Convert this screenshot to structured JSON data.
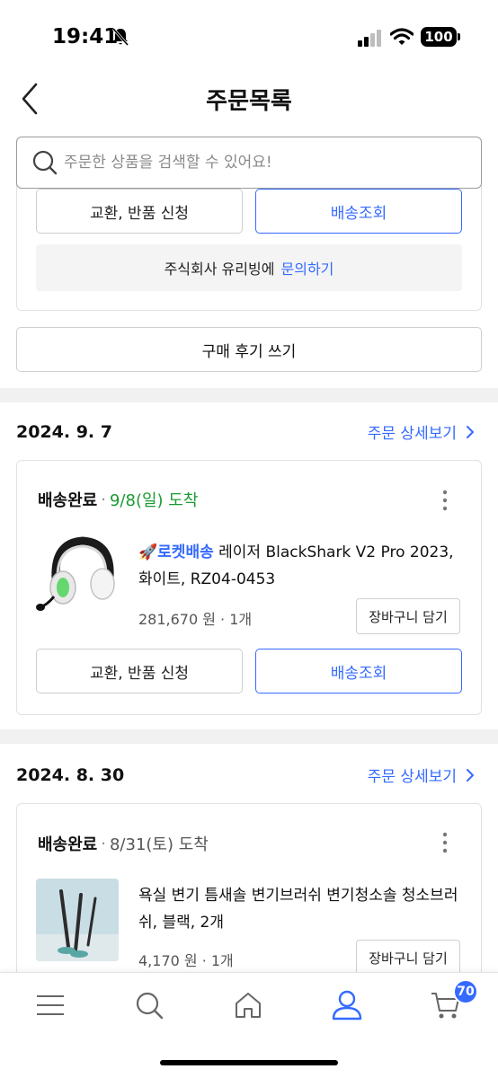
{
  "status_bar": {
    "time": "19:41",
    "battery": "100"
  },
  "header": {
    "title": "주문목록"
  },
  "search": {
    "placeholder": "주문한 상품을 검색할 수 있어요!"
  },
  "prev_order": {
    "exchange_label": "교환, 반품 신청",
    "tracking_label": "배송조회",
    "inquiry_prefix": "주식회사 유리빙에 ",
    "inquiry_link": "문의하기",
    "review_label": "구매 후기 쓰기"
  },
  "orders": [
    {
      "date": "2024. 9. 7",
      "detail_label": "주문 상세보기",
      "status": "배송완료",
      "separator": "·",
      "arrival": "9/8(일) 도착",
      "rocket": "🚀로켓배송",
      "item_name": " 레이저 BlackShark V2 Pro 2023, 화이트, RZ04-0453",
      "price": "281,670 원 · 1개",
      "cart_label": "장바구니 담기",
      "exchange_label": "교환, 반품 신청",
      "tracking_label": "배송조회"
    },
    {
      "date": "2024. 8. 30",
      "detail_label": "주문 상세보기",
      "status": "배송완료",
      "separator": "·",
      "arrival": "8/31(토) 도착",
      "item_name": "욕실 변기 틈새솔 변기브러쉬 변기청소솔 청소브러쉬, 블랙, 2개",
      "price": "4,170 원 · 1개",
      "cart_label": "장바구니 담기"
    }
  ],
  "bottom_nav": {
    "cart_badge": "70"
  },
  "colors": {
    "accent": "#346aff",
    "arrival_green": "#1a9a32"
  }
}
